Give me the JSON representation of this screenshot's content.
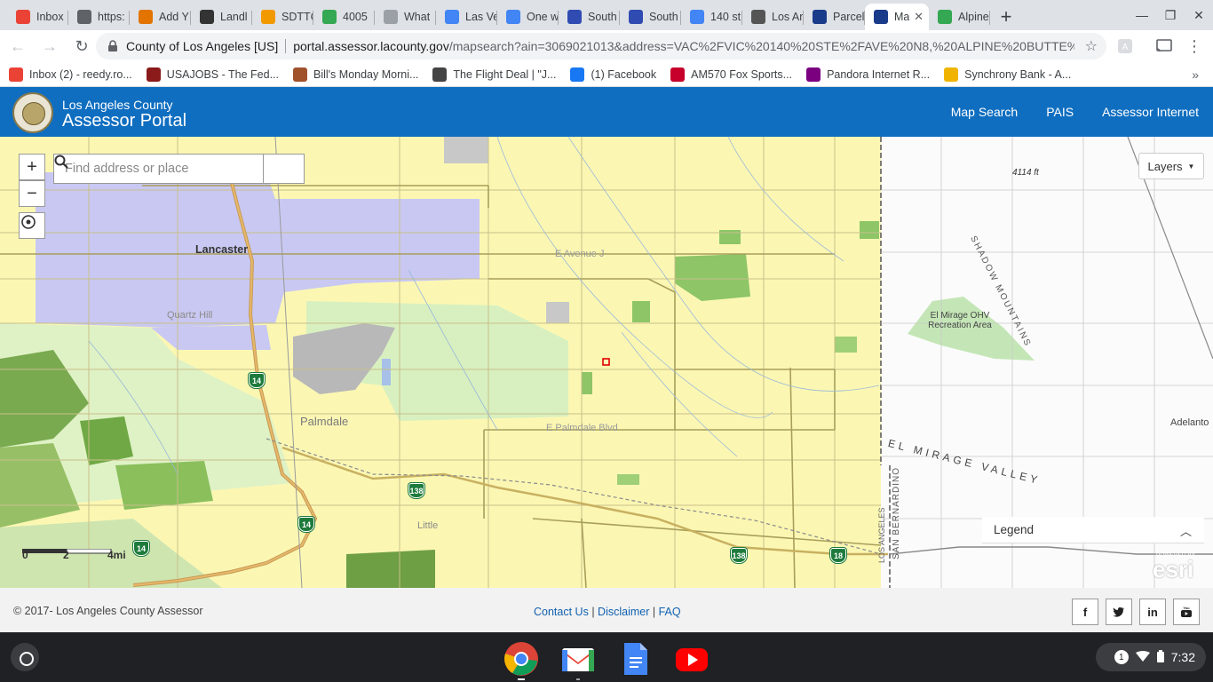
{
  "browser": {
    "tabs": [
      {
        "label": "Inbox",
        "icon": "gmail-icon",
        "color": "#ea4335"
      },
      {
        "label": "https:",
        "icon": "document-icon",
        "color": "#5f6368"
      },
      {
        "label": "Add Y",
        "icon": "mobile-app-icon",
        "color": "#e37400"
      },
      {
        "label": "Landl",
        "icon": "landlord-icon",
        "color": "#333333"
      },
      {
        "label": "SDTTC",
        "icon": "sdttc-icon",
        "color": "#f29900"
      },
      {
        "label": "4005",
        "icon": "google-drive-icon",
        "color": "#34a853"
      },
      {
        "label": "What",
        "icon": "blank-page-icon",
        "color": "#9aa0a6"
      },
      {
        "label": "Las Ve",
        "icon": "google-travel-icon",
        "color": "#4285f4"
      },
      {
        "label": "One w",
        "icon": "google-travel-icon",
        "color": "#4285f4"
      },
      {
        "label": "South",
        "icon": "southwest-heart-icon",
        "color": "#304cb2"
      },
      {
        "label": "South",
        "icon": "southwest-heart-icon",
        "color": "#304cb2"
      },
      {
        "label": "140 st",
        "icon": "google-g-icon",
        "color": "#4285f4"
      },
      {
        "label": "Los An",
        "icon": "la-seal-icon",
        "color": "#555555"
      },
      {
        "label": "Parcel",
        "icon": "assessor-icon",
        "color": "#1a3b8a"
      },
      {
        "label": "Ma",
        "icon": "assessor-icon",
        "color": "#1a3b8a"
      },
      {
        "label": "Alpine",
        "icon": "google-maps-pin-icon",
        "color": "#34a853"
      }
    ],
    "active_tab_index": 14,
    "address": {
      "site": "County of Los Angeles [US]",
      "host": "portal.assessor.lacounty.gov",
      "path": "/mapsearch?ain=3069021013&address=VAC%2FVIC%20140%20STE%2FAVE%20N8,%20ALPINE%20BUTTE%2..."
    },
    "bookmarks": [
      {
        "label": "Inbox (2) - reedy.ro...",
        "icon": "gmail-icon",
        "color": "#ea4335"
      },
      {
        "label": "USAJOBS - The Fed...",
        "icon": "usajobs-eagle-icon",
        "color": "#8b1a1a"
      },
      {
        "label": "Bill's Monday Morni...",
        "icon": "person-photo-icon",
        "color": "#a0522d"
      },
      {
        "label": "The Flight Deal | \"J...",
        "icon": "globe-icon",
        "color": "#444444"
      },
      {
        "label": "(1) Facebook",
        "icon": "facebook-icon",
        "color": "#1877f2"
      },
      {
        "label": "AM570 Fox Sports...",
        "icon": "iheart-icon",
        "color": "#c6002b"
      },
      {
        "label": "Pandora Internet R...",
        "icon": "pandora-icon",
        "color": "#7a0080"
      },
      {
        "label": "Synchrony Bank - A...",
        "icon": "synchrony-icon",
        "color": "#f0b400"
      }
    ]
  },
  "app": {
    "brand_top": "Los Angeles County",
    "brand_main": "Assessor Portal",
    "nav": [
      "Map Search",
      "PAIS",
      "Assessor Internet"
    ],
    "header_color": "#0f6ec0"
  },
  "map": {
    "search_placeholder": "Find address or place",
    "zoom_in": "+",
    "zoom_out": "−",
    "layers_label": "Layers",
    "legend_label": "Legend",
    "labels": {
      "lancaster": "Lancaster",
      "quartz_hill": "Quartz Hill",
      "palmdale": "Palmdale",
      "little": "Little",
      "e_avenue": "E Avenue J",
      "e_palmdale": "E Palmdale Blvd",
      "elevation": "4114 ft",
      "shadow_mountains": "SHADOW MOUNTAINS",
      "el_mirage_area": "El Mirage OHV Recreation Area",
      "el_mirage_valley": "EL MIRAGE VALLEY",
      "adelanto": "Adelanto",
      "los_angeles": "LOS ANGELES",
      "san_bernardino": "SAN BERNARDINO",
      "esri_powered": "POWERED BY",
      "esri": "esri"
    },
    "highways": [
      "14",
      "14",
      "14",
      "138",
      "138",
      "18"
    ],
    "scale": {
      "ticks": [
        "0",
        "2",
        "4mi"
      ]
    }
  },
  "footer": {
    "copyright": "© 2017- Los Angeles County Assessor",
    "links": [
      "Contact Us",
      "Disclaimer",
      "FAQ"
    ],
    "social": [
      "facebook-icon",
      "twitter-icon",
      "linkedin-icon",
      "youtube-icon"
    ]
  },
  "shelf": {
    "apps": [
      "chrome-icon",
      "gmail-icon",
      "google-docs-icon",
      "youtube-icon"
    ],
    "notification_count": "1",
    "time": "7:32"
  }
}
